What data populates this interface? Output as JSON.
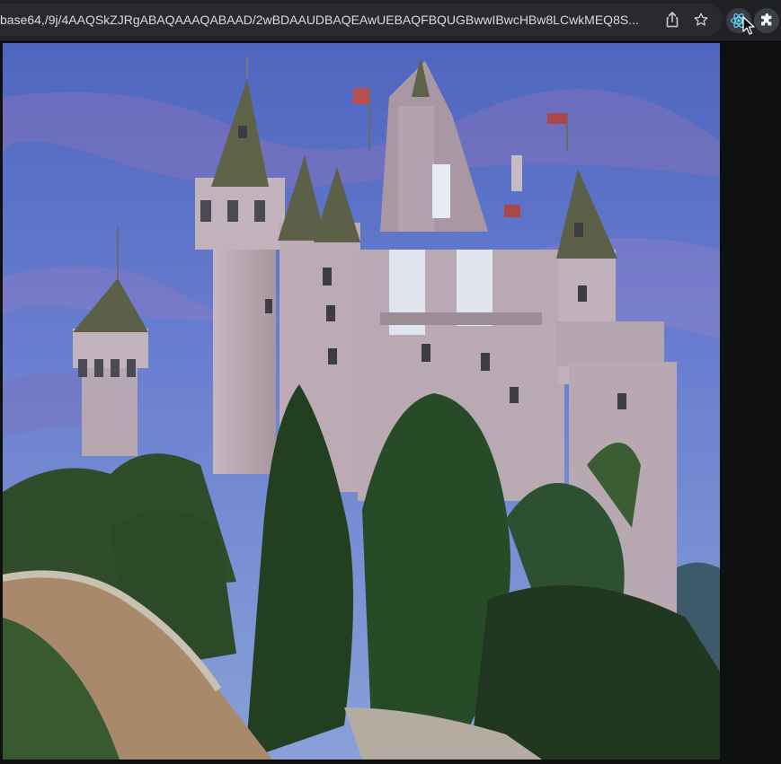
{
  "browser": {
    "url": "base64,/9j/4AAQSkZJRgABAQAAAQABAAD/2wBDAAUDBAQEAwUEBAQFBQUGBwwIBwcHBw8LCwkMEQ8S...",
    "share_icon": "share-icon",
    "star_icon": "star-icon",
    "extensions": [
      "react-devtools-icon",
      "puzzle-icon"
    ]
  },
  "page": {
    "image_subject": "castle"
  },
  "colors": {
    "toolbar_bg": "#202124",
    "omnibox_bg": "#282a2e",
    "page_bg": "#0f1110",
    "sky": "#5a70c8",
    "stone": "#b8a8b0",
    "roof": "#5c6048",
    "foliage": "#2f4d2a"
  }
}
